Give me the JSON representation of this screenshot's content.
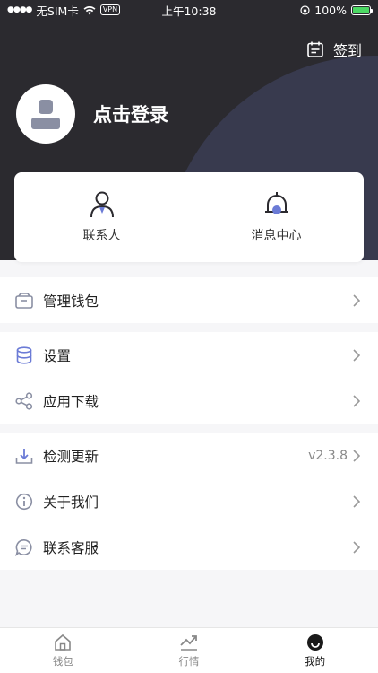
{
  "status_bar": {
    "carrier": "无SIM卡",
    "vpn": "VPN",
    "time": "上午10:38",
    "battery": "100%"
  },
  "header": {
    "checkin_label": "签到",
    "login_label": "点击登录"
  },
  "quick_actions": [
    {
      "label": "联系人",
      "icon": "contacts-icon"
    },
    {
      "label": "消息中心",
      "icon": "bell-icon"
    }
  ],
  "menu": {
    "wallet_manage": "管理钱包",
    "settings": "设置",
    "app_download": "应用下载",
    "check_update": "检测更新",
    "version": "v2.3.8",
    "about_us": "关于我们",
    "customer_service": "联系客服"
  },
  "tabs": [
    {
      "label": "钱包",
      "icon": "home-icon"
    },
    {
      "label": "行情",
      "icon": "trend-icon"
    },
    {
      "label": "我的",
      "icon": "profile-icon",
      "active": true
    }
  ],
  "colors": {
    "header_bg": "#2b2a2f",
    "header_accent": "#383a4e",
    "icon_accent": "#6b7bd6",
    "icon_gray": "#8a8fa3"
  }
}
